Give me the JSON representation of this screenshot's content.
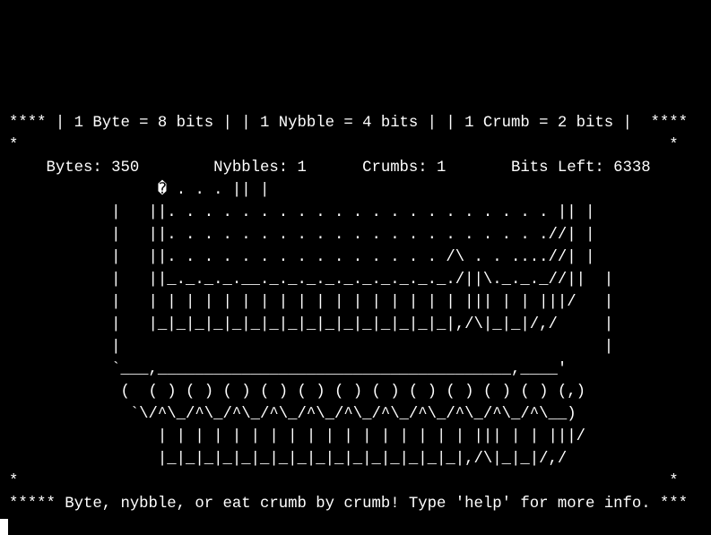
{
  "terminal": {
    "header_line": "**** | 1 Byte = 8 bits | | 1 Nybble = 4 bits | | 1 Crumb = 2 bits |  ****",
    "border_top": "*                                                                      *",
    "stats_line": "    Bytes: 350        Nybbles: 1      Crumbs: 1       Bits Left: 6338",
    "art_lines": [
      "                � . . . || |",
      "           |   ||. . . . . . . . . . . . . . . . . . . . . || |",
      "           |   ||. . . . . . . . . . . . . . . . . . . . .//| |",
      "           |   ||. . . . . . . . . . . . . . . /\\ . . ....//| |",
      "           |   ||_._._._.__._._._._._._._._._._./||\\._._._//||  |",
      "           |   | | | | | | | | | | | | | | | | | ||| | | |||/   |",
      "           |   |_|_|_|_|_|_|_|_|_|_|_|_|_|_|_|_|,/\\|_|_|/,/     |",
      "           |                                                    |",
      "           `___,______________________________________,____'",
      "            (  ( ) ( ) ( ) ( ) ( ) ( ) ( ) ( ) ( ) ( ) ( ) (,)",
      "             `\\/^\\_/^\\_/^\\_/^\\_/^\\_/^\\_/^\\_/^\\_/^\\_/^\\_/^\\__)",
      "                | | | | | | | | | | | | | | | | | ||| | | |||/",
      "                |_|_|_|_|_|_|_|_|_|_|_|_|_|_|_|_|,/\\|_|_|/,/"
    ],
    "border_bottom": "*                                                                      *",
    "footer_line": "***** Byte, nybble, or eat crumb by crumb! Type 'help' for more info. ***"
  },
  "colors": {
    "background": "#000000",
    "foreground": "#ffffff"
  }
}
